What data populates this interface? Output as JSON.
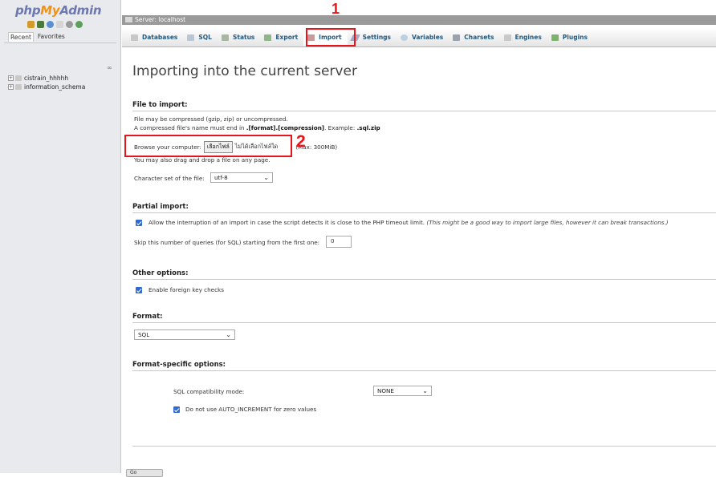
{
  "nav": {
    "logo": {
      "php": "php",
      "my": "My",
      "admin": "Admin"
    },
    "quick_icons": [
      "home-icon",
      "exit-icon",
      "help-icon",
      "docs-icon",
      "settings-icon",
      "reload-icon"
    ],
    "tabs": [
      "Recent",
      "Favorites"
    ],
    "collapse_glyph": "∞",
    "databases": [
      "cistrain_hhhhh",
      "information_schema"
    ]
  },
  "breadcrumb": {
    "server": "Server: localhost"
  },
  "menu": {
    "items": [
      {
        "label": "Databases",
        "icon": "database-icon"
      },
      {
        "label": "SQL",
        "icon": "sql-icon"
      },
      {
        "label": "Status",
        "icon": "status-icon"
      },
      {
        "label": "Export",
        "icon": "export-icon"
      },
      {
        "label": "Import",
        "icon": "import-icon",
        "active": true
      },
      {
        "label": "Settings",
        "icon": "settings-icon"
      },
      {
        "label": "Variables",
        "icon": "variables-icon"
      },
      {
        "label": "Charsets",
        "icon": "charsets-icon"
      },
      {
        "label": "Engines",
        "icon": "engines-icon"
      },
      {
        "label": "Plugins",
        "icon": "plugins-icon"
      }
    ]
  },
  "annotations": {
    "one": "1",
    "two": "2"
  },
  "main": {
    "title": "Importing into the current server",
    "file_to_import": {
      "heading": "File to import:",
      "line1": "File may be compressed (gzip, zip) or uncompressed.",
      "line2_prefix": "A compressed file's name must end in ",
      "line2_bold": ".[format].[compression]",
      "line2_mid": ". Example: ",
      "line2_example": ".sql.zip",
      "browse_label": "Browse your computer:",
      "browse_button": "เลือกไฟล์",
      "no_file": "ไม่ได้เลือกไฟล์ใด",
      "max_size": "(Max: 300MiB)",
      "drag_hint": "You may also drag and drop a file on any page.",
      "charset_label": "Character set of the file:",
      "charset_value": "utf-8"
    },
    "partial_import": {
      "heading": "Partial import:",
      "allow_interrupt": "Allow the interruption of an import in case the script detects it is close to the PHP timeout limit.",
      "allow_interrupt_note": "(This might be a good way to import large files, however it can break transactions.)",
      "skip_label": "Skip this number of queries (for SQL) starting from the first one:",
      "skip_value": "0"
    },
    "other_options": {
      "heading": "Other options:",
      "foreign_keys": "Enable foreign key checks"
    },
    "format": {
      "heading": "Format:",
      "value": "SQL"
    },
    "format_specific": {
      "heading": "Format-specific options:",
      "compat_label": "SQL compatibility mode:",
      "compat_value": "NONE",
      "auto_increment": "Do not use AUTO_INCREMENT for zero values"
    },
    "go_button": "Go"
  },
  "colors": {
    "accent": "#235a81",
    "annotation": "#e8141b",
    "checkbox": "#2e6ad1"
  }
}
